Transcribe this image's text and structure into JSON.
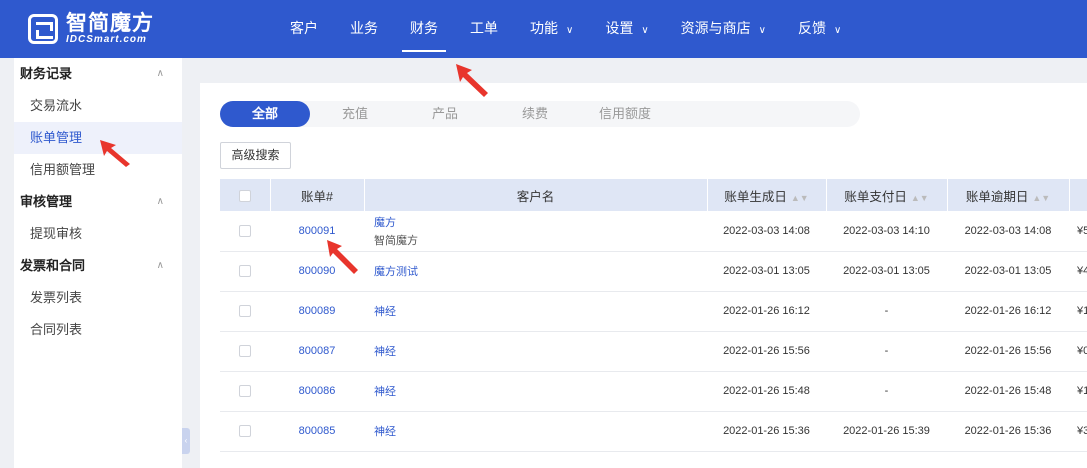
{
  "brand": {
    "name": "智简魔方",
    "subtitle": "IDCSmart.com"
  },
  "nav": [
    {
      "label": "客户",
      "dropdown": false
    },
    {
      "label": "业务",
      "dropdown": false
    },
    {
      "label": "财务",
      "dropdown": false,
      "active": true
    },
    {
      "label": "工单",
      "dropdown": false
    },
    {
      "label": "功能",
      "dropdown": true
    },
    {
      "label": "设置",
      "dropdown": true
    },
    {
      "label": "资源与商店",
      "dropdown": true
    },
    {
      "label": "反馈",
      "dropdown": true
    }
  ],
  "sidebar": {
    "groups": [
      {
        "label": "财务记录",
        "items": [
          "交易流水",
          "账单管理",
          "信用额管理"
        ]
      },
      {
        "label": "审核管理",
        "items": [
          "提现审核"
        ]
      },
      {
        "label": "发票和合同",
        "items": [
          "发票列表",
          "合同列表"
        ]
      }
    ],
    "active_item": "账单管理"
  },
  "tabs": [
    "全部",
    "充值",
    "产品",
    "续费",
    "信用额度"
  ],
  "advanced_search_label": "高级搜索",
  "table": {
    "headers": [
      "账单#",
      "客户名",
      "账单生成日",
      "账单支付日",
      "账单逾期日"
    ],
    "rows": [
      {
        "id": "800091",
        "customer": "魔方",
        "customer_sub": "智简魔方",
        "created": "2022-03-03 14:08",
        "paid": "2022-03-03 14:10",
        "due": "2022-03-03 14:08",
        "extra": "¥5"
      },
      {
        "id": "800090",
        "customer": "魔方测试",
        "customer_sub": "",
        "created": "2022-03-01 13:05",
        "paid": "2022-03-01 13:05",
        "due": "2022-03-01 13:05",
        "extra": "¥4"
      },
      {
        "id": "800089",
        "customer": "神经",
        "customer_sub": "",
        "created": "2022-01-26 16:12",
        "paid": "-",
        "due": "2022-01-26 16:12",
        "extra": "¥1"
      },
      {
        "id": "800087",
        "customer": "神经",
        "customer_sub": "",
        "created": "2022-01-26 15:56",
        "paid": "-",
        "due": "2022-01-26 15:56",
        "extra": "¥0"
      },
      {
        "id": "800086",
        "customer": "神经",
        "customer_sub": "",
        "created": "2022-01-26 15:48",
        "paid": "-",
        "due": "2022-01-26 15:48",
        "extra": "¥1"
      },
      {
        "id": "800085",
        "customer": "神经",
        "customer_sub": "",
        "created": "2022-01-26 15:36",
        "paid": "2022-01-26 15:39",
        "due": "2022-01-26 15:36",
        "extra": "¥3"
      }
    ]
  },
  "colors": {
    "primary": "#2f59ce",
    "header_bg": "#dfe6f5",
    "annotation": "#e8352c"
  }
}
